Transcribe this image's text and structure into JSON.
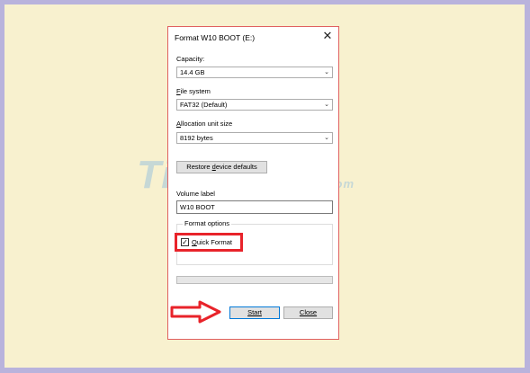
{
  "dialog": {
    "title": "Format W10 BOOT (E:)",
    "capacity": {
      "label": "Capacity:",
      "value": "14.4 GB"
    },
    "file_system": {
      "label_underlined": "F",
      "label_rest": "ile system",
      "value": "FAT32 (Default)"
    },
    "allocation": {
      "label_underlined": "A",
      "label_rest": "llocation unit size",
      "value": "8192 bytes"
    },
    "restore_button": {
      "label_pre": "Restore ",
      "label_underlined": "d",
      "label_post": "evice defaults"
    },
    "volume_label": {
      "label": "Volume label",
      "value": "W10 BOOT"
    },
    "format_options": {
      "label": "Format options",
      "quick_format": {
        "label_underlined": "Q",
        "label_rest": "uick Format",
        "checked": true,
        "check_glyph": "✓"
      }
    },
    "progress": {
      "value": 0
    },
    "buttons": {
      "start": "Start",
      "close": "Close",
      "close_glyph": "✕"
    }
  },
  "watermark": {
    "text": "TipsMake",
    "suffix": ".com"
  },
  "colors": {
    "highlight": "#e8232a",
    "background": "#f8f1cf",
    "frame": "#b9b3dc"
  }
}
